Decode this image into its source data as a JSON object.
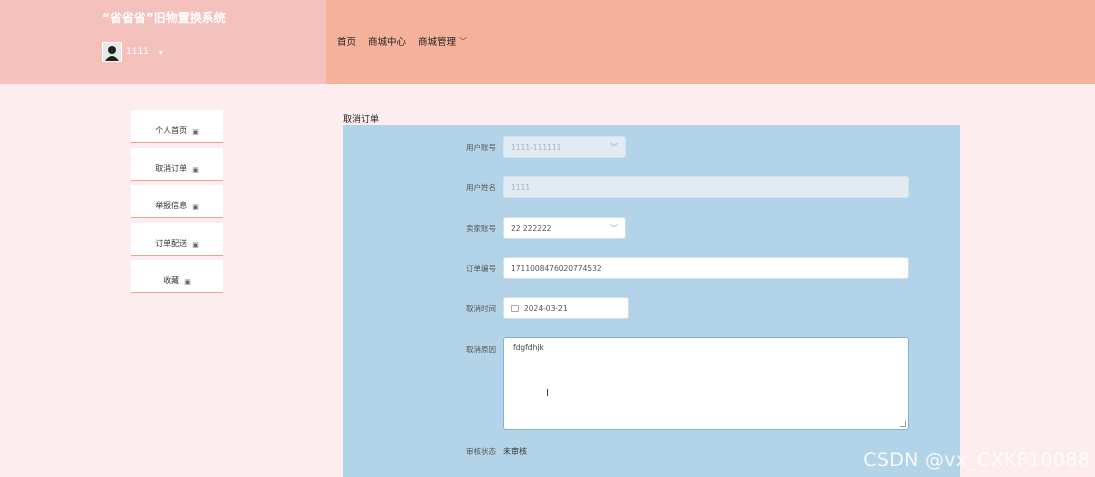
{
  "header": {
    "app_title": "“省省省”旧物置换系统",
    "username": "1111",
    "user_caret": "▾",
    "nav": [
      {
        "label": "首页"
      },
      {
        "label": "商城中心"
      },
      {
        "label": "商城管理",
        "caret": "﹀"
      }
    ]
  },
  "sidebar": {
    "items": [
      {
        "label": "个人首页",
        "icon": "lock-icon"
      },
      {
        "label": "取消订单",
        "icon": "lock-icon"
      },
      {
        "label": "举报信息",
        "icon": "lock-icon"
      },
      {
        "label": "订单配送",
        "icon": "lock-icon"
      },
      {
        "label": "收藏",
        "icon": "lock-icon"
      }
    ]
  },
  "main": {
    "section_title": "取消订单",
    "form": {
      "user_account": {
        "label": "用户账号",
        "value": "1111-111111"
      },
      "user_name": {
        "label": "用户姓名",
        "value": "1111"
      },
      "seller_account": {
        "label": "卖家账号",
        "value": "22 222222"
      },
      "order_no": {
        "label": "订单编号",
        "value": "171100847602077453​2"
      },
      "cancel_time": {
        "label": "取消时间",
        "value": "2024-03-21"
      },
      "cancel_reason": {
        "label": "取消原因",
        "value": "fdgfdhjk"
      },
      "review_status": {
        "label": "审核状态",
        "value": "未审核"
      }
    }
  },
  "watermark": "CSDN @vx_CXKF10088",
  "colors": {
    "header_left": "#f5c1bd",
    "header_right": "#f5b199",
    "page_bg": "#fdedef",
    "form_bg": "#b3d4e8",
    "sidebar_accent": "#f0a48a"
  }
}
